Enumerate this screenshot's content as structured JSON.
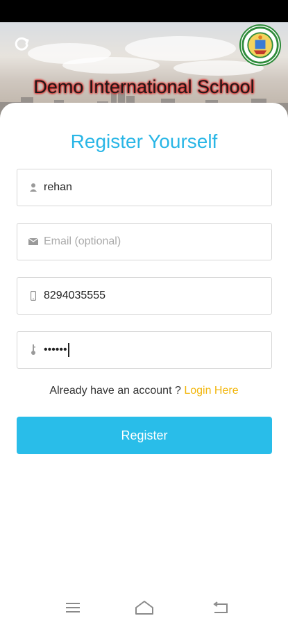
{
  "app": {
    "school_name": "Demo International School"
  },
  "form": {
    "title": "Register Yourself",
    "name": {
      "value": "rehan",
      "icon": "person-icon"
    },
    "email": {
      "value": "",
      "placeholder": "Email (optional)",
      "icon": "mail-icon"
    },
    "phone": {
      "value": "8294035555",
      "icon": "phone-icon"
    },
    "password": {
      "value": "••••••",
      "icon": "key-icon"
    },
    "account_prompt": "Already have an account ?",
    "login_link": "Login Here",
    "register_label": "Register"
  },
  "colors": {
    "accent": "#29bde9",
    "link": "#f2b60c"
  }
}
